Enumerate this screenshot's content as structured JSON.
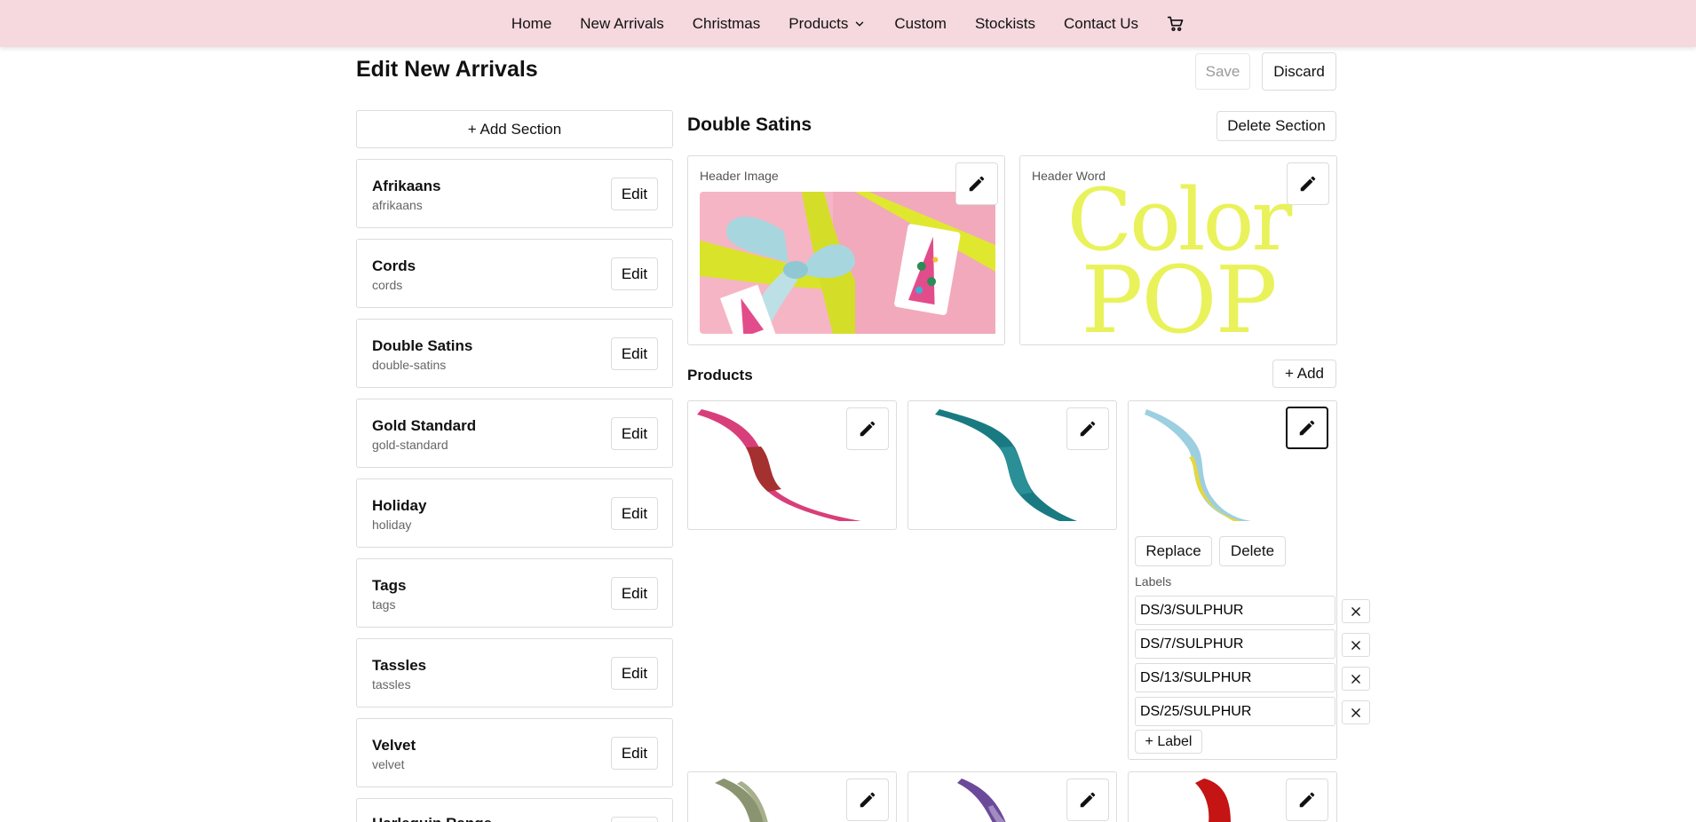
{
  "nav": {
    "items": [
      "Home",
      "New Arrivals",
      "Christmas",
      "Products",
      "Custom",
      "Stockists",
      "Contact Us"
    ],
    "cart_icon": "cart-icon"
  },
  "page": {
    "title": "Edit New Arrivals",
    "save_label": "Save",
    "discard_label": "Discard"
  },
  "sidebar": {
    "add_section_label": "+ Add Section",
    "edit_label": "Edit",
    "items": [
      {
        "name": "Afrikaans",
        "slug": "afrikaans"
      },
      {
        "name": "Cords",
        "slug": "cords"
      },
      {
        "name": "Double Satins",
        "slug": "double-satins"
      },
      {
        "name": "Gold Standard",
        "slug": "gold-standard"
      },
      {
        "name": "Holiday",
        "slug": "holiday"
      },
      {
        "name": "Tags",
        "slug": "tags"
      },
      {
        "name": "Tassles",
        "slug": "tassles"
      },
      {
        "name": "Velvet",
        "slug": "velvet"
      },
      {
        "name": "Harlequin Range",
        "slug": ""
      }
    ]
  },
  "section": {
    "title": "Double Satins",
    "delete_label": "Delete Section",
    "header_image_caption": "Header Image",
    "header_word_caption": "Header Word",
    "header_word_lines": [
      "Color",
      "POP"
    ],
    "products_title": "Products",
    "add_label": "+ Add",
    "replace_label": "Replace",
    "delete_label_product": "Delete",
    "labels_caption": "Labels",
    "labels": [
      "DS/3/SULPHUR",
      "DS/7/SULPHUR",
      "DS/13/SULPHUR",
      "DS/25/SULPHUR"
    ],
    "add_label_btn": "+ Label"
  },
  "colors": {
    "nav_bg": "#f5d9df",
    "header_word": "#e9f25a"
  }
}
